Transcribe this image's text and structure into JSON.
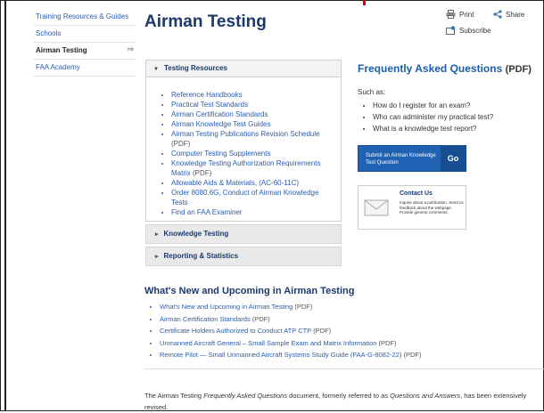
{
  "nav": {
    "items": [
      {
        "label": "Training Resources & Guides",
        "active": false
      },
      {
        "label": "Schools",
        "active": false
      },
      {
        "label": "Airman Testing",
        "active": true,
        "arrow": "⇒"
      },
      {
        "label": "FAA Academy",
        "active": false
      }
    ]
  },
  "page": {
    "title": "Airman Testing"
  },
  "tools": {
    "print": "Print",
    "share": "Share",
    "subscribe": "Subscribe"
  },
  "testing_resources": {
    "header": "Testing Resources",
    "links": [
      {
        "text": "Reference Handbooks"
      },
      {
        "text": "Practical Test Standards"
      },
      {
        "text": "Airman Certification Standards"
      },
      {
        "text": "Airman Knowledge Test Guides"
      },
      {
        "text": "Airman Testing Publications Revision Schedule",
        "note": "(PDF)"
      },
      {
        "text": "Computer Testing Supplements"
      },
      {
        "text": "Knowledge Testing Authorization Requirements Matrix",
        "note": "(PDF)"
      },
      {
        "text": "Allowable Aids & Materials, (AC-60-11C)"
      },
      {
        "text": "Order 8080.6G, Conduct of Airman Knowledge Tests"
      },
      {
        "text": "Find an FAA Examiner"
      }
    ]
  },
  "sections": {
    "knowledge": "Knowledge Testing",
    "reporting": "Reporting & Statistics"
  },
  "faq": {
    "title": "Frequently Asked Questions",
    "title_note": "(PDF)",
    "such_as": "Such as:",
    "questions": [
      "How do I register for an exam?",
      "Who can administer my practical test?",
      "What is a knowledge test report?"
    ],
    "button_text": "Submit an Airman Knowledge Test Question",
    "button_go": "Go"
  },
  "contact": {
    "title": "Contact Us",
    "lines": "Inquire about a publication. Send us feedback about the webpage. Provide general comments."
  },
  "whats_new": {
    "title": "What's New and Upcoming in Airman Testing",
    "items": [
      {
        "text": "What's New and Upcoming in Airman Testing",
        "note": "(PDF)"
      },
      {
        "text": "Airman Certification Standards",
        "note": "(PDF)"
      },
      {
        "text": "Certificate Holders Authorized to Conduct ATP CTP",
        "note": "(PDF)"
      },
      {
        "text": "Unmanned Aircraft General – Small Sample Exam and Matrix Information",
        "note": "(PDF)"
      },
      {
        "text": "Remote Pilot — Small Unmanned Aircraft Systems Study Guide (FAA-G-8082-22)",
        "note": "(PDF)"
      }
    ]
  },
  "paragraph": {
    "before": "The Airman Testing ",
    "em1": "Frequently Asked Questions",
    "mid": " document, formerly referred to as ",
    "em2": "Questions and Answers",
    "after": ", has been extensively revised."
  },
  "colors": {
    "link": "#2a5db0",
    "title": "#1b3a6b",
    "button": "#1f62b4"
  }
}
